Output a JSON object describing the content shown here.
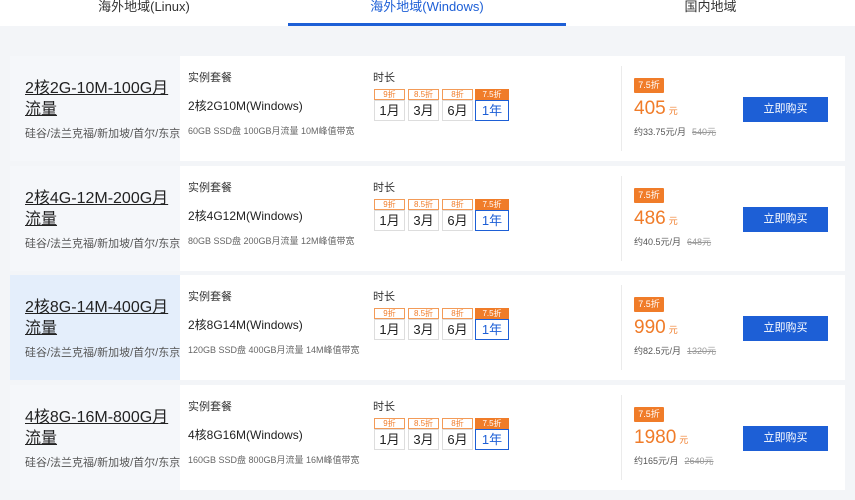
{
  "tabs": [
    {
      "label": "海外地域(Linux)"
    },
    {
      "label": "海外地域(Windows)"
    },
    {
      "label": "国内地域"
    }
  ],
  "labels": {
    "spec": "实例套餐",
    "duration": "时长",
    "buy": "立即购买"
  },
  "durations": [
    "1月",
    "3月",
    "6月",
    "1年"
  ],
  "discounts": [
    "9折",
    "8.5折",
    "8折",
    "7.5折"
  ],
  "colors": {
    "accent": "#1d5fd6",
    "price": "#f07c29"
  },
  "plans": [
    {
      "name": "2核2G-10M-100G月流量",
      "regions": "硅谷/法兰克福/新加坡/首尔/东京",
      "spec": "2核2G10M(Windows)",
      "desc": "60GB SSD盘 100GB月流量 10M峰值带宽",
      "discount": "7.5折",
      "price": "405",
      "unit": "元",
      "monthly": "约33.75元/月",
      "original": "540元"
    },
    {
      "name": "2核4G-12M-200G月流量",
      "regions": "硅谷/法兰克福/新加坡/首尔/东京",
      "spec": "2核4G12M(Windows)",
      "desc": "80GB SSD盘 200GB月流量 12M峰值带宽",
      "discount": "7.5折",
      "price": "486",
      "unit": "元",
      "monthly": "约40.5元/月",
      "original": "648元"
    },
    {
      "name": "2核8G-14M-400G月流量",
      "regions": "硅谷/法兰克福/新加坡/首尔/东京",
      "spec": "2核8G14M(Windows)",
      "desc": "120GB SSD盘 400GB月流量 14M峰值带宽",
      "discount": "7.5折",
      "price": "990",
      "unit": "元",
      "monthly": "约82.5元/月",
      "original": "1320元"
    },
    {
      "name": "4核8G-16M-800G月流量",
      "regions": "硅谷/法兰克福/新加坡/首尔/东京",
      "spec": "4核8G16M(Windows)",
      "desc": "160GB SSD盘 800GB月流量 16M峰值带宽",
      "discount": "7.5折",
      "price": "1980",
      "unit": "元",
      "monthly": "约165元/月",
      "original": "2640元"
    }
  ]
}
